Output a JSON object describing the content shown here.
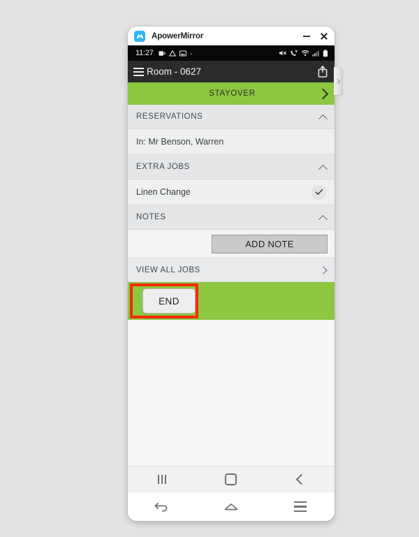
{
  "window": {
    "app_name": "ApowerMirror",
    "logo_icon": "apowermirror-logo-icon",
    "minimize_label": "–",
    "close_label": "×"
  },
  "status_bar": {
    "time": "11:27",
    "left_icons": [
      "video-recorder-icon",
      "google-drive-icon",
      "photo-icon",
      "dot-icon"
    ],
    "right_icons": [
      "mute-ringer-icon",
      "volte-call-icon",
      "wifi-icon",
      "signal-bars-icon",
      "battery-icon"
    ]
  },
  "app_header": {
    "menu_icon": "hamburger-menu-icon",
    "title": "Room - 0627",
    "share_icon": "share-upload-icon"
  },
  "stayover": {
    "label": "STAYOVER",
    "chevron_icon": "chevron-right-icon",
    "color": "#8dc63f"
  },
  "sections": [
    {
      "header": "RESERVATIONS",
      "collapse_icon": "chevron-up-icon",
      "rows": [
        {
          "label": "In: Mr Benson, Warren",
          "trailing": null
        }
      ]
    },
    {
      "header": "EXTRA JOBS",
      "collapse_icon": "chevron-up-icon",
      "rows": [
        {
          "label": "Linen Change",
          "trailing": "check-icon"
        }
      ]
    },
    {
      "header": "NOTES",
      "collapse_icon": "chevron-up-icon",
      "rows": []
    }
  ],
  "notes": {
    "add_note_label": "ADD NOTE"
  },
  "view_all_jobs": {
    "label": "VIEW ALL JOBS",
    "chevron_icon": "chevron-right-icon"
  },
  "end_bar": {
    "end_label": "END",
    "highlight_color": "#f42b0b",
    "bar_color": "#8dc63f"
  },
  "android_nav": {
    "recents_icon": "recents-icon",
    "home_icon": "home-square-icon",
    "back_icon": "back-chevron-icon"
  },
  "mirror_nav": {
    "back_icon": "back-arrow-icon",
    "home_icon": "home-outline-icon",
    "menu_icon": "menu-lines-icon"
  },
  "edge_handle": {
    "icon": "chevron-right-icon"
  }
}
